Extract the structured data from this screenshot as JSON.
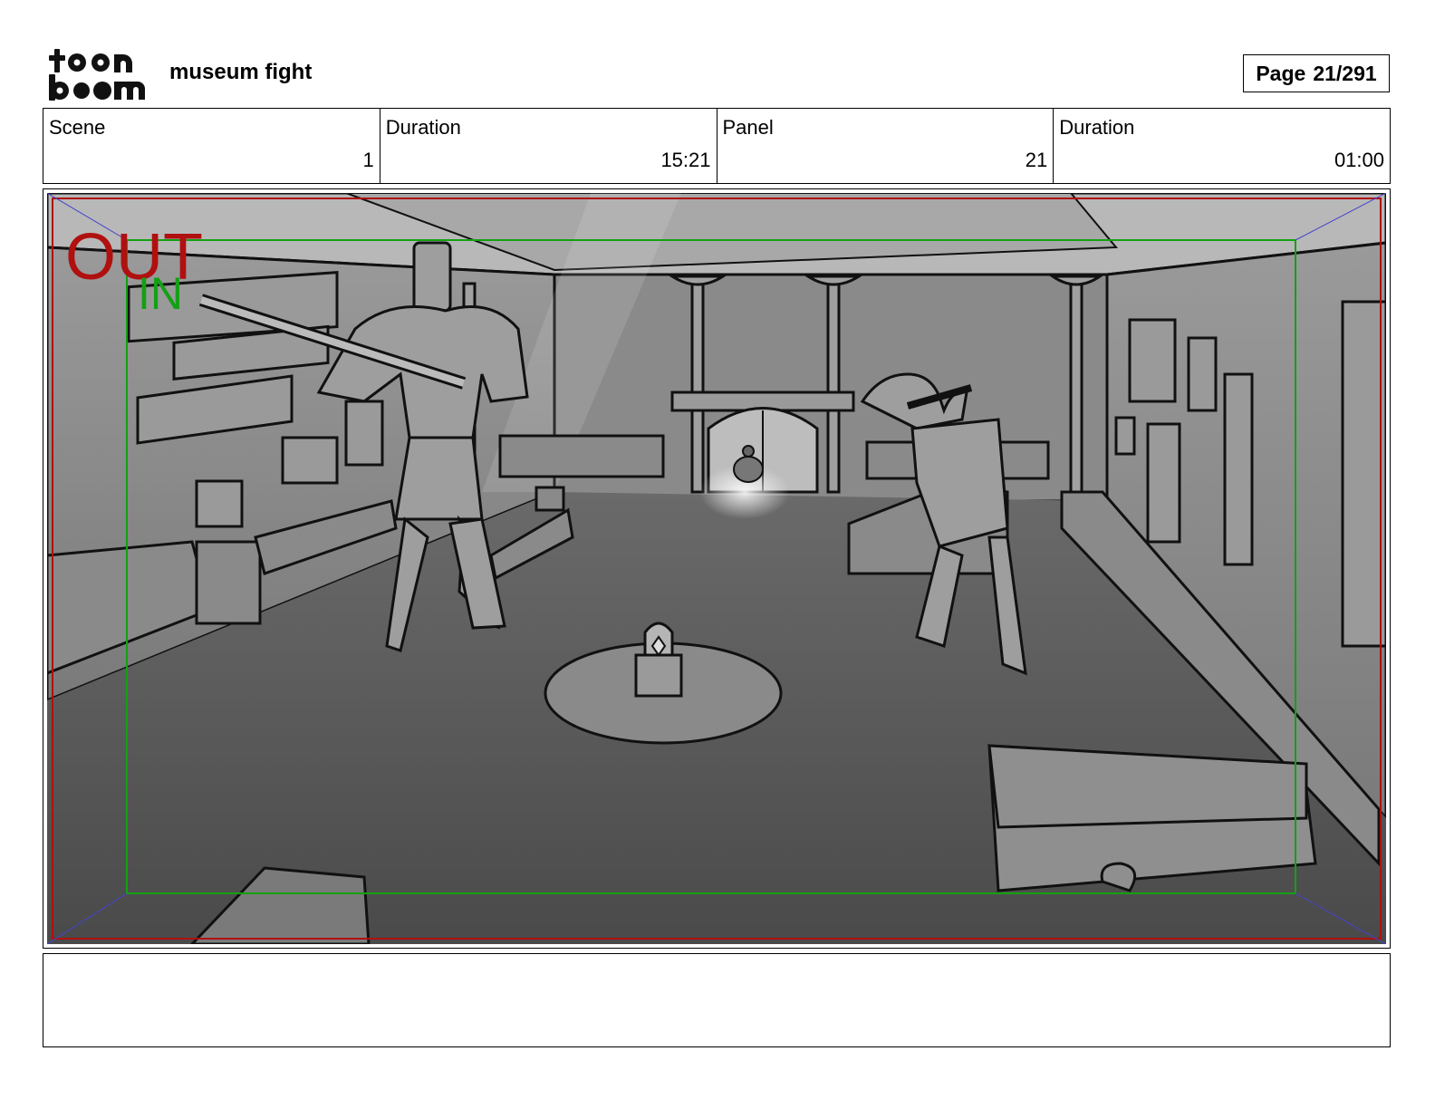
{
  "header": {
    "logo_text_top": "toon",
    "logo_text_bottom": "boom",
    "project_title": "museum fight",
    "page_label": "Page",
    "page_number": "21/291"
  },
  "info": {
    "scene_label": "Scene",
    "scene_value": "1",
    "scene_duration_label": "Duration",
    "scene_duration_value": "15:21",
    "panel_label": "Panel",
    "panel_value": "21",
    "panel_duration_label": "Duration",
    "panel_duration_value": "01:00"
  },
  "panel": {
    "out_label": "OUT",
    "in_label": "IN",
    "out_color": "#b01010",
    "in_color": "#14a014"
  },
  "caption": {
    "text": ""
  }
}
